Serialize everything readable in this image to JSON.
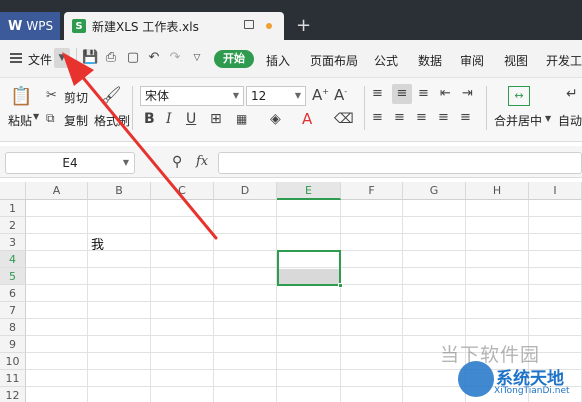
{
  "tabs": {
    "wps_label": "WPS",
    "document_title": "新建XLS 工作表.xls",
    "new_tab": "+"
  },
  "menu": {
    "file": "文件",
    "start": "开始",
    "items": [
      "插入",
      "页面布局",
      "公式",
      "数据",
      "审阅",
      "视图",
      "开发工"
    ]
  },
  "ribbon": {
    "paste": "粘贴",
    "cut": "剪切",
    "copy": "复制",
    "format_painter": "格式刷",
    "font_name": "宋体",
    "font_size": "12",
    "merge_center": "合并居中",
    "auto_wrap": "自动"
  },
  "formula_bar": {
    "cell_ref": "E4",
    "fx": "fx",
    "value": ""
  },
  "sheet": {
    "columns": [
      "A",
      "B",
      "C",
      "D",
      "E",
      "F",
      "G",
      "H",
      "I"
    ],
    "rows": [
      "1",
      "2",
      "3",
      "4",
      "5",
      "6",
      "7",
      "8",
      "9",
      "10",
      "11",
      "12"
    ],
    "active_column": "E",
    "active_rows": [
      "4",
      "5"
    ],
    "cells": [
      {
        "ref": "B3",
        "text": "我"
      }
    ]
  },
  "watermark": {
    "line1": "当下软件园",
    "line2": "系统天地",
    "line3": "XiTongTianDi.net"
  },
  "colors": {
    "accent_green": "#2e9b4f",
    "tabbar_bg": "#2b2f36",
    "wps_tab_bg": "#3c5a99",
    "arrow_red": "#e8322d"
  }
}
